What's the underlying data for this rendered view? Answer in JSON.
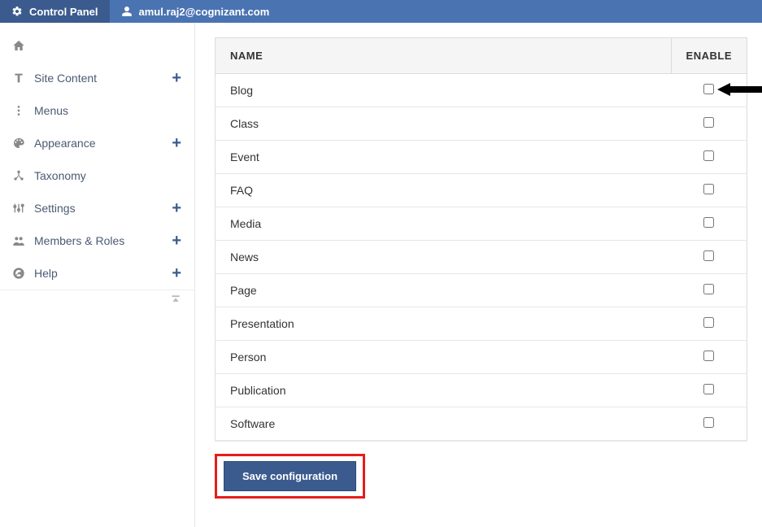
{
  "topbar": {
    "control_panel_label": "Control Panel",
    "user_label": "amul.raj2@cognizant.com"
  },
  "sidebar": {
    "items": [
      {
        "id": "home",
        "label": "",
        "icon": "home-icon",
        "plus": false
      },
      {
        "id": "site-content",
        "label": "Site Content",
        "icon": "text-icon",
        "plus": true
      },
      {
        "id": "menus",
        "label": "Menus",
        "icon": "dots-icon",
        "plus": false
      },
      {
        "id": "appearance",
        "label": "Appearance",
        "icon": "palette-icon",
        "plus": true
      },
      {
        "id": "taxonomy",
        "label": "Taxonomy",
        "icon": "taxonomy-icon",
        "plus": false
      },
      {
        "id": "settings",
        "label": "Settings",
        "icon": "sliders-icon",
        "plus": true
      },
      {
        "id": "members",
        "label": "Members & Roles",
        "icon": "people-icon",
        "plus": true
      },
      {
        "id": "help",
        "label": "Help",
        "icon": "help-icon",
        "plus": true
      }
    ]
  },
  "table": {
    "headers": {
      "name": "NAME",
      "enable": "ENABLE"
    },
    "rows": [
      {
        "name": "Blog",
        "enabled": false
      },
      {
        "name": "Class",
        "enabled": false
      },
      {
        "name": "Event",
        "enabled": false
      },
      {
        "name": "FAQ",
        "enabled": false
      },
      {
        "name": "Media",
        "enabled": false
      },
      {
        "name": "News",
        "enabled": false
      },
      {
        "name": "Page",
        "enabled": false
      },
      {
        "name": "Presentation",
        "enabled": false
      },
      {
        "name": "Person",
        "enabled": false
      },
      {
        "name": "Publication",
        "enabled": false
      },
      {
        "name": "Software",
        "enabled": false
      }
    ]
  },
  "buttons": {
    "save_label": "Save configuration"
  }
}
